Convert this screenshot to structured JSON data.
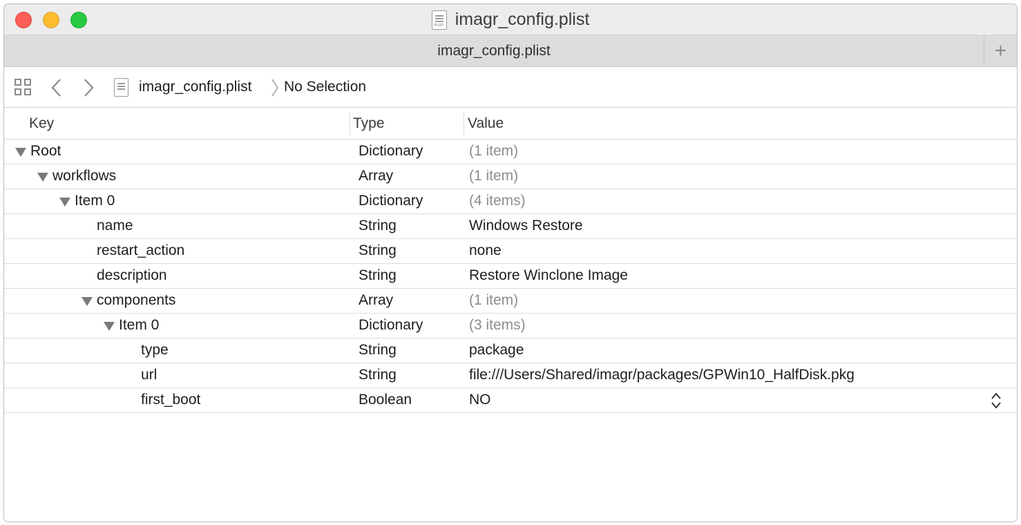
{
  "window": {
    "title": "imagr_config.plist",
    "doc_icon_tag": "PLIST"
  },
  "tabs": {
    "active_label": "imagr_config.plist",
    "add_label": "+"
  },
  "jumpbar": {
    "file": "imagr_config.plist",
    "selection": "No Selection"
  },
  "columns": {
    "key": "Key",
    "type": "Type",
    "value": "Value"
  },
  "rows": [
    {
      "key": "Root",
      "type": "Dictionary",
      "value": "(1 item)",
      "level": 0,
      "expanded": true,
      "dim": true
    },
    {
      "key": "workflows",
      "type": "Array",
      "value": "(1 item)",
      "level": 1,
      "expanded": true,
      "dim": true
    },
    {
      "key": "Item 0",
      "type": "Dictionary",
      "value": "(4 items)",
      "level": 2,
      "expanded": true,
      "dim": true
    },
    {
      "key": "name",
      "type": "String",
      "value": "Windows Restore",
      "level": 3,
      "expanded": false,
      "dim": false
    },
    {
      "key": "restart_action",
      "type": "String",
      "value": "none",
      "level": 3,
      "expanded": false,
      "dim": false
    },
    {
      "key": "description",
      "type": "String",
      "value": "Restore Winclone Image",
      "level": 3,
      "expanded": false,
      "dim": false
    },
    {
      "key": "components",
      "type": "Array",
      "value": "(1 item)",
      "level": 3,
      "expanded": true,
      "dim": true
    },
    {
      "key": "Item 0",
      "type": "Dictionary",
      "value": "(3 items)",
      "level": 4,
      "expanded": true,
      "dim": true
    },
    {
      "key": "type",
      "type": "String",
      "value": "package",
      "level": 5,
      "expanded": false,
      "dim": false
    },
    {
      "key": "url",
      "type": "String",
      "value": "file:///Users/Shared/imagr/packages/GPWin10_HalfDisk.pkg",
      "level": 5,
      "expanded": false,
      "dim": false
    },
    {
      "key": "first_boot",
      "type": "Boolean",
      "value": "NO",
      "level": 5,
      "expanded": false,
      "dim": false,
      "stepper": true
    }
  ]
}
